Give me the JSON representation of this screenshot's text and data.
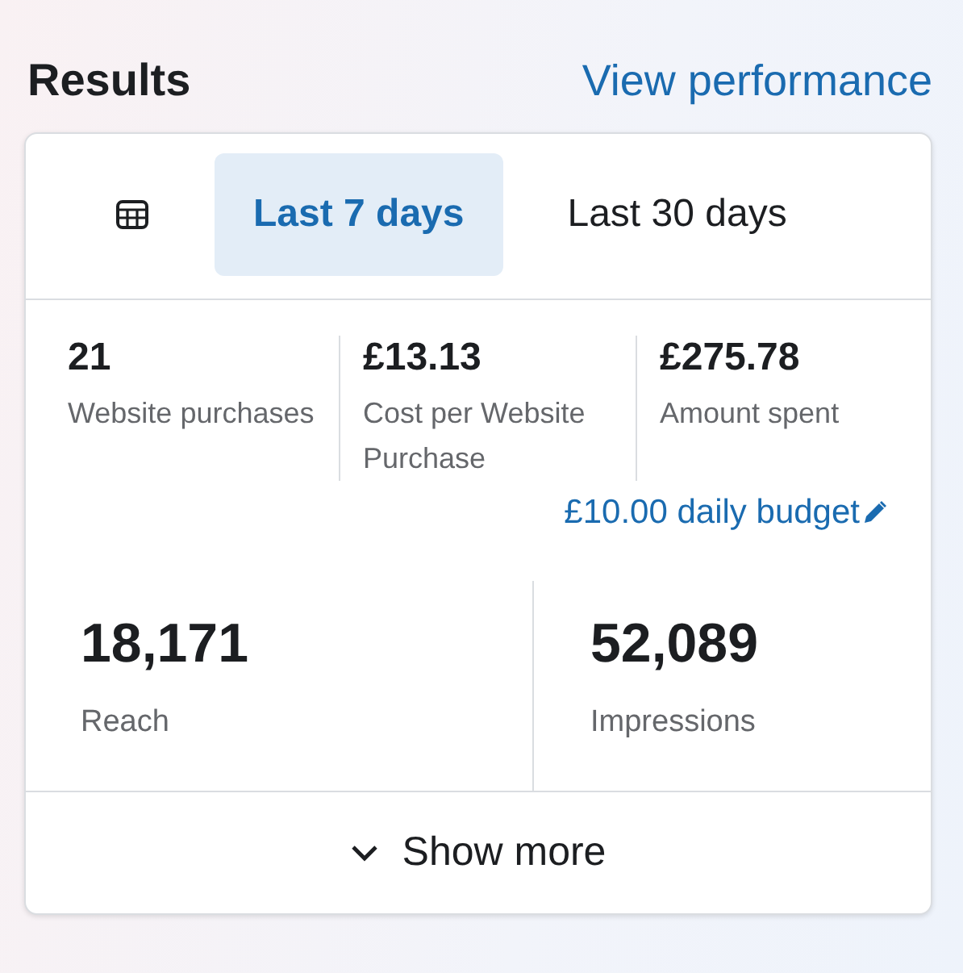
{
  "header": {
    "title": "Results",
    "link": "View performance"
  },
  "tabs": [
    {
      "kind": "icon",
      "selected": false
    },
    {
      "kind": "text",
      "label": "Last 7 days",
      "selected": true
    },
    {
      "kind": "text",
      "label": "Last 30 days",
      "selected": false
    }
  ],
  "metrics": [
    {
      "value": "21",
      "label": "Website purchases"
    },
    {
      "value": "£13.13",
      "label": "Cost per Website Purchase"
    },
    {
      "value": "£275.78",
      "label": "Amount spent"
    }
  ],
  "budget": "£10.00 daily budget",
  "big_metrics": [
    {
      "value": "18,171",
      "label": "Reach"
    },
    {
      "value": "52,089",
      "label": "Impressions"
    }
  ],
  "show_more": "Show more"
}
